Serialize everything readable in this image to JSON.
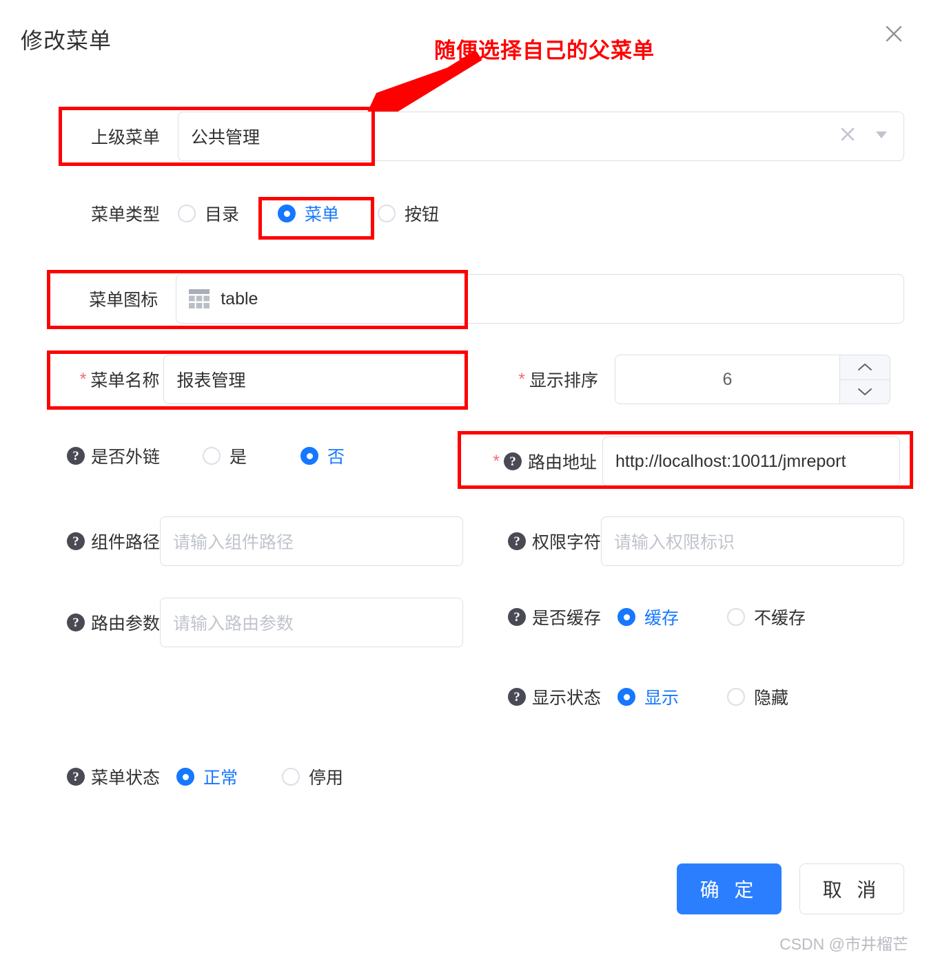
{
  "dialog": {
    "title": "修改菜单",
    "close_icon": "close-icon"
  },
  "annotation": {
    "text": "随便选择自己的父菜单",
    "color": "#ff0000"
  },
  "form": {
    "parent_menu": {
      "label": "上级菜单",
      "value": "公共管理",
      "clear_icon": "clear-icon",
      "arrow_icon": "chevron-down-icon"
    },
    "menu_type": {
      "label": "菜单类型",
      "options": [
        {
          "label": "目录",
          "checked": false
        },
        {
          "label": "菜单",
          "checked": true
        },
        {
          "label": "按钮",
          "checked": false
        }
      ]
    },
    "menu_icon": {
      "label": "菜单图标",
      "value": "table",
      "icon": "table-icon"
    },
    "menu_name": {
      "label": "菜单名称",
      "required": true,
      "value": "报表管理"
    },
    "order_num": {
      "label": "显示排序",
      "required": true,
      "value": "6",
      "up_icon": "chevron-up-icon",
      "down_icon": "chevron-down-icon"
    },
    "is_frame": {
      "label": "是否外链",
      "help_icon": "question-icon",
      "options": [
        {
          "label": "是",
          "checked": false
        },
        {
          "label": "否",
          "checked": true
        }
      ]
    },
    "path": {
      "label": "路由地址",
      "required": true,
      "help_icon": "question-icon",
      "value": "http://localhost:10011/jmreport"
    },
    "component": {
      "label": "组件路径",
      "help_icon": "question-icon",
      "value": "",
      "placeholder": "请输入组件路径"
    },
    "perms": {
      "label": "权限字符",
      "help_icon": "question-icon",
      "value": "",
      "placeholder": "请输入权限标识"
    },
    "query": {
      "label": "路由参数",
      "help_icon": "question-icon",
      "value": "",
      "placeholder": "请输入路由参数"
    },
    "is_cache": {
      "label": "是否缓存",
      "help_icon": "question-icon",
      "options": [
        {
          "label": "缓存",
          "checked": true
        },
        {
          "label": "不缓存",
          "checked": false
        }
      ]
    },
    "visible": {
      "label": "显示状态",
      "help_icon": "question-icon",
      "options": [
        {
          "label": "显示",
          "checked": true
        },
        {
          "label": "隐藏",
          "checked": false
        }
      ]
    },
    "status": {
      "label": "菜单状态",
      "help_icon": "question-icon",
      "options": [
        {
          "label": "正常",
          "checked": true
        },
        {
          "label": "停用",
          "checked": false
        }
      ]
    }
  },
  "footer": {
    "confirm_label": "确 定",
    "cancel_label": "取 消"
  },
  "watermark": "CSDN @市井榴芒"
}
